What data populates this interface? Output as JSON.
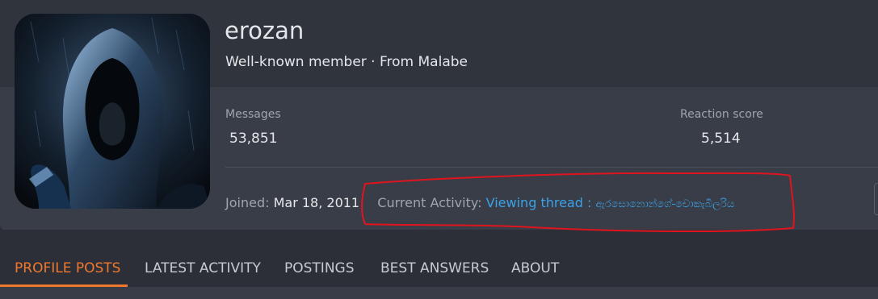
{
  "profile": {
    "username": "erozan",
    "subtitle": "Well-known member · From Malabe",
    "avatar_icon": "hooded-figure-avatar"
  },
  "stats": {
    "messages_label": "Messages",
    "messages_value": "53,851",
    "reaction_label": "Reaction score",
    "reaction_value": "5,514"
  },
  "meta": {
    "joined_label": "Joined:",
    "joined_value": "Mar 18, 2011",
    "activity_label": "Current Activity:",
    "activity_link": "Viewing thread :",
    "activity_thread": "ඇරසොනොන්ගේ-චොකැබිලරිය"
  },
  "tabs": [
    {
      "label": "PROFILE POSTS"
    },
    {
      "label": "LATEST ACTIVITY"
    },
    {
      "label": "POSTINGS"
    },
    {
      "label": "BEST ANSWERS"
    },
    {
      "label": "ABOUT"
    }
  ],
  "colors": {
    "accent": "#f0782c",
    "link": "#3aa2e8",
    "annotation": "#e0141e"
  }
}
